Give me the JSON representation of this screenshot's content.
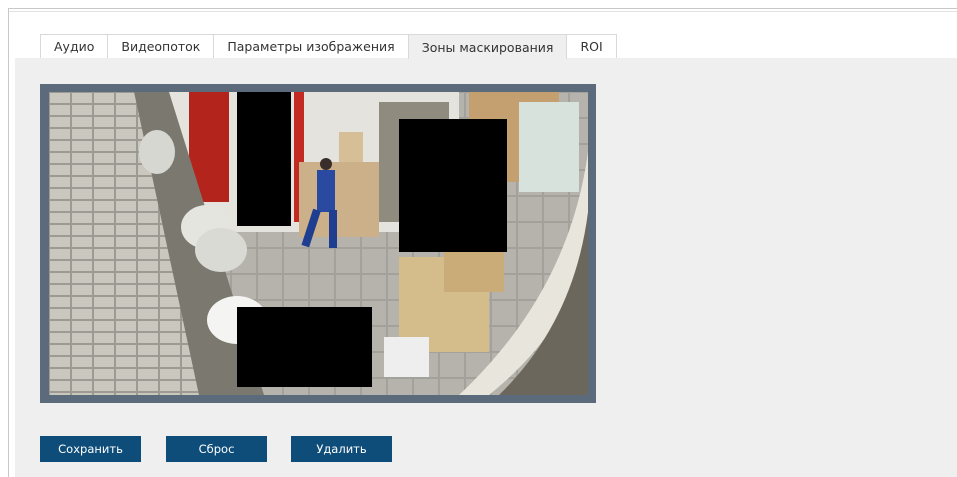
{
  "tabs": [
    {
      "label": "Аудио",
      "active": false
    },
    {
      "label": "Видеопоток",
      "active": false
    },
    {
      "label": "Параметры изображения",
      "active": false
    },
    {
      "label": "Зоны маскирования",
      "active": true
    },
    {
      "label": "ROI",
      "active": false
    }
  ],
  "buttons": {
    "save": "Сохранить",
    "reset": "Сброс",
    "delete": "Удалить"
  },
  "colors": {
    "button_bg": "#0e4d7a",
    "video_border": "#5c6b7b",
    "panel_bg": "#efefef",
    "mask": "#000000"
  },
  "privacy_masks": [
    {
      "id": 1
    },
    {
      "id": 2
    },
    {
      "id": 3
    }
  ]
}
